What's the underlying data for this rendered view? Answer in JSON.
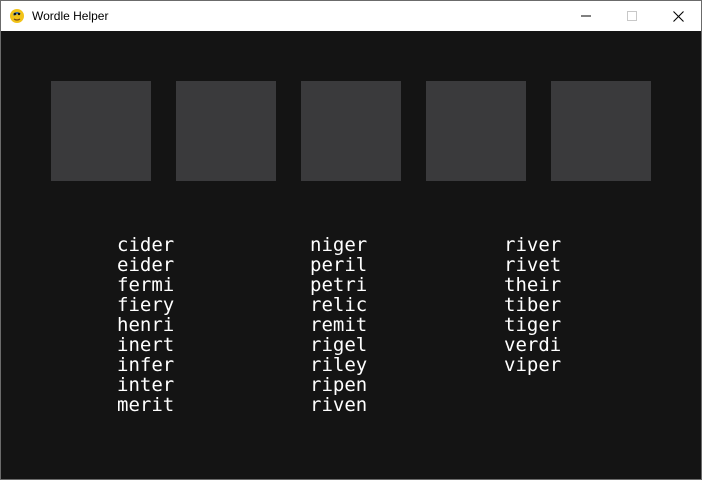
{
  "window": {
    "title": "Wordle Helper",
    "controls": [
      "minimize-icon",
      "maximize-icon",
      "close-icon"
    ]
  },
  "tiles": [
    {
      "letter": ""
    },
    {
      "letter": ""
    },
    {
      "letter": ""
    },
    {
      "letter": ""
    },
    {
      "letter": ""
    }
  ],
  "colors": {
    "background": "#141414",
    "tile": "#3a3a3c",
    "text": "#ffffff"
  },
  "word_columns": [
    [
      "cider",
      "eider",
      "fermi",
      "fiery",
      "henri",
      "inert",
      "infer",
      "inter",
      "merit"
    ],
    [
      "niger",
      "peril",
      "petri",
      "relic",
      "remit",
      "rigel",
      "riley",
      "ripen",
      "riven"
    ],
    [
      "river",
      "rivet",
      "their",
      "tiber",
      "tiger",
      "verdi",
      "viper"
    ]
  ]
}
